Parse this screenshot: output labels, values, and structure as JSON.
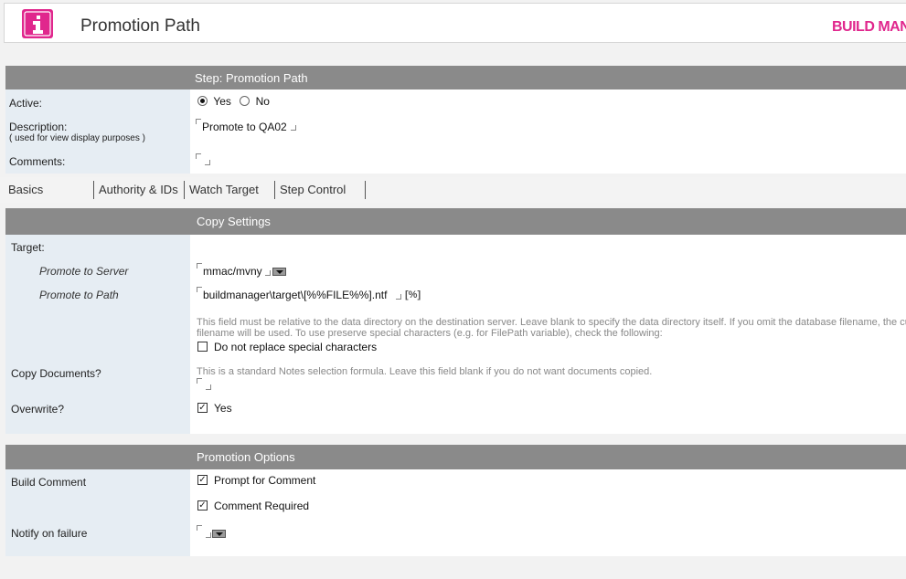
{
  "header": {
    "title": "Promotion Path",
    "brand": "BUILD MANAGER"
  },
  "step": {
    "bar_label": "Step:  Promotion Path",
    "active_label": "Active:",
    "active_options": [
      "Yes",
      "No"
    ],
    "active_selected": "Yes",
    "description_label": "Description:",
    "description_hint": "( used for view display purposes )",
    "description_value": "Promote to QA02",
    "comments_label": "Comments:",
    "comments_value": ""
  },
  "tabs": [
    "Basics",
    "Authority & IDs",
    "Watch Target",
    "Step Control"
  ],
  "active_tab": "Basics",
  "copy": {
    "bar_label": "Copy Settings",
    "target_label": "Target:",
    "server_label": "Promote to Server",
    "server_value": "mmac/mvny",
    "path_label": "Promote to Path",
    "path_value": "buildmanager\\target\\[%%FILE%%].ntf",
    "path_macro": "[%]",
    "path_note_1": "This field must be relative to the data directory on the destination server. Leave blank to specify the data directory itself. If you omit the database filename, the current",
    "path_note_2": "filename will be used. To use preserve special characters (e.g. for FilePath variable), check the following:",
    "no_replace_label": "Do not replace special characters",
    "no_replace_checked": false,
    "copydocs_label": "Copy Documents?",
    "copydocs_note": "This is a standard Notes selection formula. Leave this field blank if you do not want documents copied.",
    "overwrite_label": "Overwrite?",
    "overwrite_option": "Yes",
    "overwrite_checked": true
  },
  "promotion": {
    "bar_label": "Promotion Options",
    "build_comment_label": "Build Comment",
    "prompt_label": "Prompt for Comment",
    "prompt_checked": true,
    "required_label": "Comment Required",
    "required_checked": true,
    "notify_label": "Notify on failure",
    "notify_value": ""
  },
  "colors": {
    "brand": "#e0278d",
    "bar": "#8a8a8a",
    "label_bg": "#e6edf3"
  },
  "icons": [
    "app-logo-icon",
    "dropdown-arrow-icon",
    "checkbox-check-icon",
    "radio-dot-icon"
  ]
}
